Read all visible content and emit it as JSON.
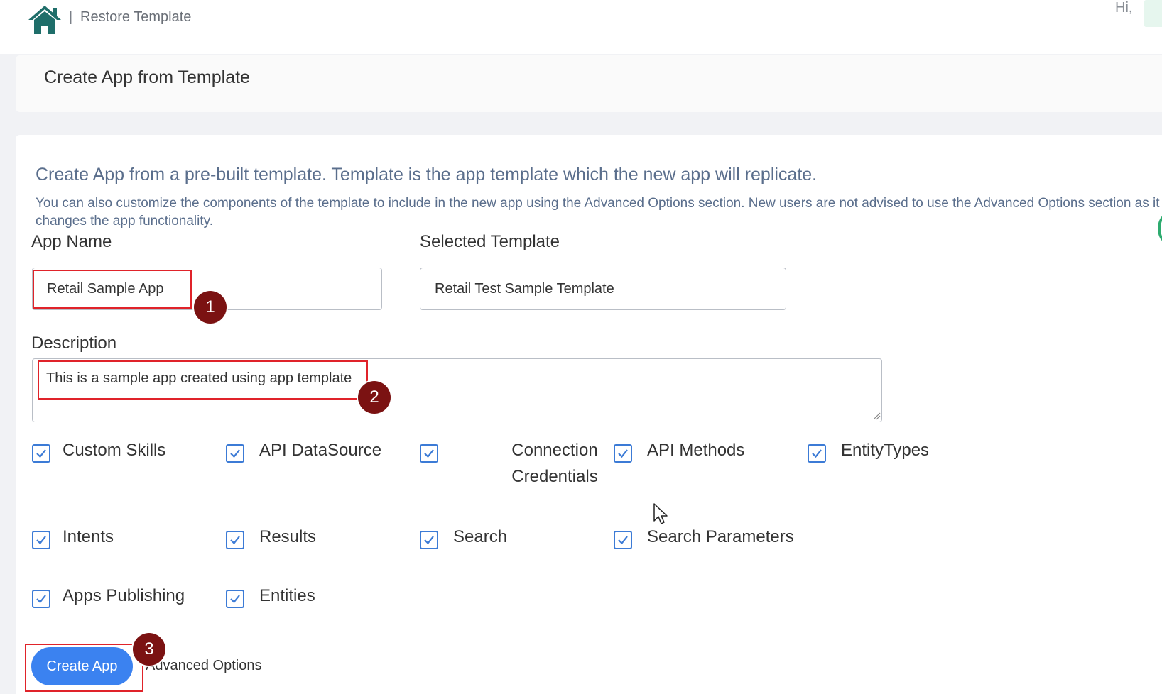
{
  "header": {
    "breadcrumb_separator": "|",
    "breadcrumb": "Restore Template",
    "greeting": "Hi,"
  },
  "page_title": "Create App from Template",
  "intro": {
    "main": "Create App from a pre-built template. Template is the app template which the new app will replicate.",
    "sub": "You can also customize the components of the template to include in the new app using the Advanced Options section. New users are not advised to use the Advanced Options section as it changes the app functionality."
  },
  "form": {
    "app_name_label": "App Name",
    "app_name_value": "Retail Sample App",
    "selected_template_label": "Selected Template",
    "selected_template_value": "Retail Test Sample Template",
    "description_label": "Description",
    "description_value": "This is a sample app created using app template"
  },
  "components": [
    {
      "label": "Custom Skills",
      "checked": true
    },
    {
      "label": "API DataSource",
      "checked": true
    },
    {
      "label": "Connection Credentials",
      "checked": true
    },
    {
      "label": "API Methods",
      "checked": true
    },
    {
      "label": "EntityTypes",
      "checked": true
    },
    {
      "label": "Intents",
      "checked": true
    },
    {
      "label": "Results",
      "checked": true
    },
    {
      "label": "Search",
      "checked": true
    },
    {
      "label": "Search Parameters",
      "checked": true
    },
    {
      "label": "Apps Publishing",
      "checked": true
    },
    {
      "label": "Entities",
      "checked": true
    }
  ],
  "actions": {
    "create_app": "Create App",
    "advanced_options": "Advanced Options"
  },
  "annotations": [
    "1",
    "2",
    "3"
  ],
  "colors": {
    "accent": "#3b82f0",
    "checkbox": "#3c7bd6",
    "home_icon": "#1f6e6a",
    "highlight": "#e0232a",
    "marker": "#7b1212"
  }
}
